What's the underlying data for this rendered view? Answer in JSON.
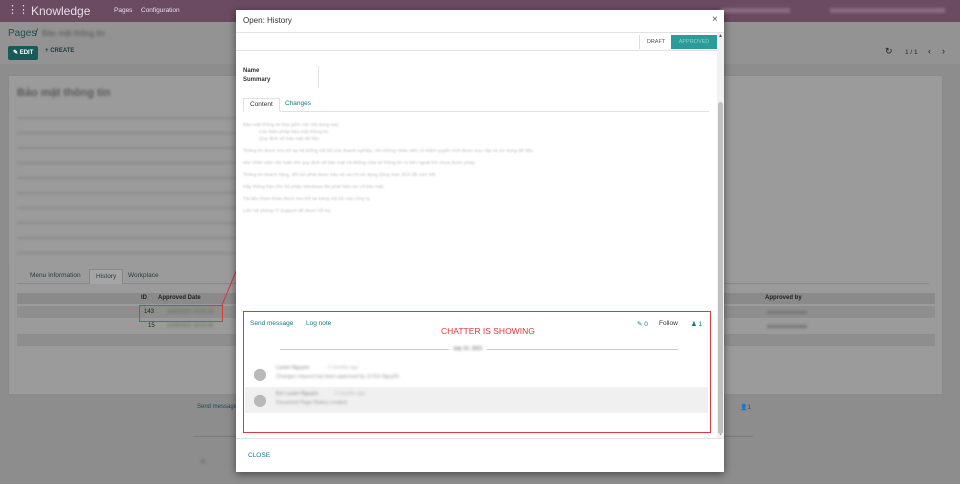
{
  "app": {
    "title": "Knowledge",
    "menu": [
      "Pages",
      "Configuration"
    ],
    "breadcrumb_root": "Pages",
    "breadcrumb_sep": "/",
    "breadcrumb_current": "Bảo mật thông tin",
    "edit_label": "EDIT",
    "create_label": "CREATE",
    "pager": "1 / 1",
    "record_title": "Bảo mật thông tin",
    "tabs": [
      "Menu Information",
      "History",
      "Workplace"
    ],
    "table_headers": {
      "id": "ID",
      "approved_date": "Approved Date",
      "approved_by": "Approved by"
    },
    "rows": [
      {
        "id": "143",
        "date": "10/06/2021 10:05:18"
      },
      {
        "id": "15",
        "date": "10/06/2021 10:02:00"
      }
    ],
    "chatter": {
      "send_message": "Send message",
      "follower_count": "1"
    }
  },
  "modal": {
    "title": "Open: History",
    "close_symbol": "×",
    "status": [
      "DRAFT",
      "APPROVED"
    ],
    "field_name_label": "Name",
    "field_summary_label": "Summary",
    "tabs": [
      "Content",
      "Changes"
    ],
    "content_paragraphs": [
      "Bảo mật thông tin bao gồm các nội dung sau:",
      "Các biện pháp bảo mật thông tin",
      "Quy định về bảo mật dữ liệu",
      "Thông tin được lưu trữ tại hệ thống nội bộ của doanh nghiệp, chỉ những nhân viên có thẩm quyền mới được truy cập và sử dụng dữ liệu.",
      "Mọi nhân viên cần tuân thủ quy định về bảo mật và không chia sẻ thông tin ra bên ngoài khi chưa được phép.",
      "Thông tin khách hàng, đối tác phải được bảo vệ và chỉ sử dụng đúng mục đích đã cam kết.",
      "Hãy thông báo cho bộ phận Windows khi phát hiện sự cố bảo mật.",
      "Tài liệu tham khảo được lưu trữ tại trang nội bộ của công ty.",
      "Liên hệ phòng IT Support để được hỗ trợ."
    ],
    "chatter": {
      "annotation": "CHATTER IS SHOWING",
      "send_message": "Send message",
      "log_note": "Log note",
      "attachments": "0",
      "follow": "Follow",
      "followers": "1",
      "date_separator": "July 10, 2021",
      "messages": [
        {
          "author": "Lucien Nguyen",
          "time": "- 3 months ago",
          "body": "Changes request has been approved by 12 Em Nguyễn"
        },
        {
          "author": "Em Lucien Nguyen",
          "time": "- 3 months ago",
          "body": "Document Page History created"
        }
      ]
    },
    "close_label": "CLOSE"
  },
  "colors": {
    "accent": "#117a85",
    "annotation_red": "#d9383f",
    "brand": "#6b4b62"
  }
}
